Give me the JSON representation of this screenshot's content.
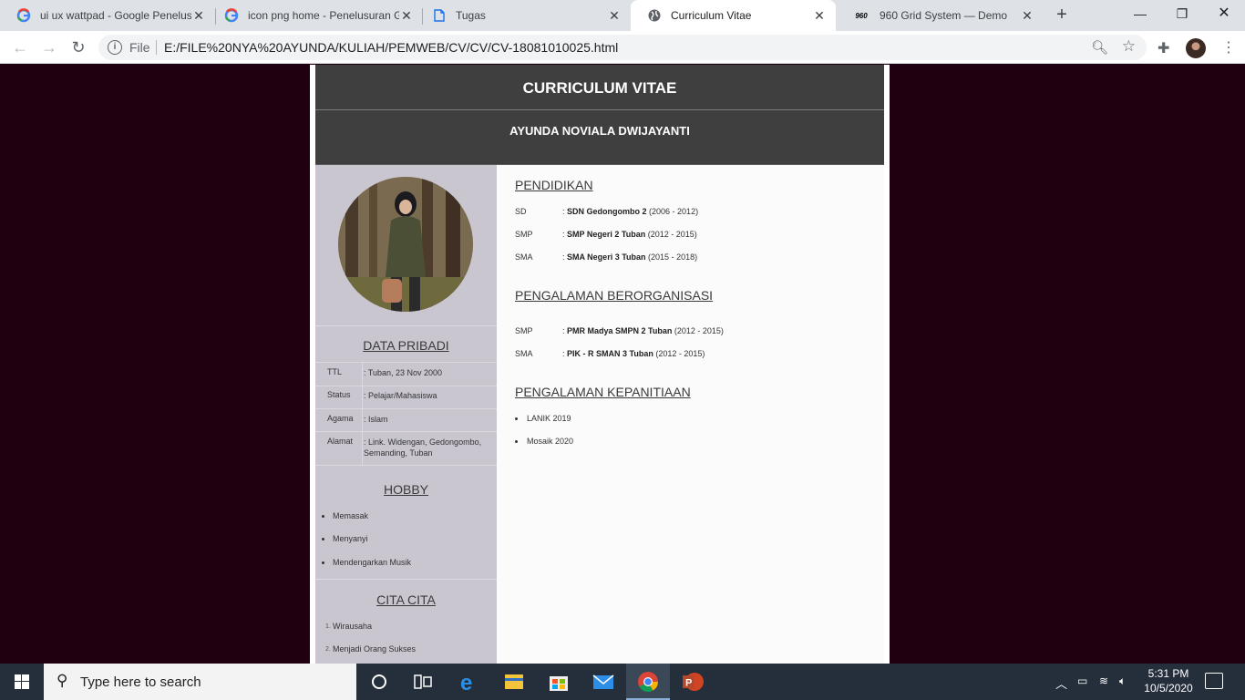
{
  "browser": {
    "tabs": [
      {
        "title": "ui ux wattpad - Google Penelusuran",
        "favicon": "google-icon"
      },
      {
        "title": "icon png home - Penelusuran Google",
        "favicon": "google-icon"
      },
      {
        "title": "Tugas",
        "favicon": "file-icon"
      },
      {
        "title": "Curriculum Vitae",
        "favicon": "globe-icon"
      },
      {
        "title": "960 Grid System — Demo",
        "favicon": "960-icon"
      }
    ],
    "active_tab": 3,
    "address": {
      "scheme_label": "File",
      "url": "E:/FILE%20NYA%20AYUNDA/KULIAH/PEMWEB/CV/CV/CV-18081010025.html"
    }
  },
  "cv": {
    "title": "CURRICULUM VITAE",
    "name": "AYUNDA NOVIALA DWIJAYANTI",
    "data_pribadi": {
      "heading": "DATA PRIBADI",
      "rows": [
        {
          "label": "TTL",
          "value": ": Tuban, 23 Nov 2000"
        },
        {
          "label": "Status",
          "value": ": Pelajar/Mahasiswa"
        },
        {
          "label": "Agama",
          "value": ": Islam"
        },
        {
          "label": "Alamat",
          "value": ": Link. Widengan, Gedongombo, Semanding, Tuban"
        }
      ]
    },
    "hobby": {
      "heading": "HOBBY",
      "items": [
        "Memasak",
        "Menyanyi",
        "Mendengarkan Musik"
      ]
    },
    "cita_cita": {
      "heading": "CITA CITA",
      "items": [
        "Wirausaha",
        "Menjadi Orang Sukses"
      ]
    },
    "pendidikan": {
      "heading": "PENDIDIKAN",
      "rows": [
        {
          "level": "SD",
          "school": "SDN Gedongombo 2",
          "years": "(2006 - 2012)"
        },
        {
          "level": "SMP",
          "school": "SMP Negeri 2 Tuban",
          "years": "(2012 - 2015)"
        },
        {
          "level": "SMA",
          "school": "SMA Negeri 3 Tuban",
          "years": "(2015 - 2018)"
        }
      ]
    },
    "organisasi": {
      "heading": "PENGALAMAN BERORGANISASI",
      "rows": [
        {
          "level": "SMP",
          "school": "PMR Madya SMPN 2 Tuban",
          "years": "(2012 - 2015)"
        },
        {
          "level": "SMA",
          "school": "PIK - R SMAN 3 Tuban",
          "years": "(2012 - 2015)"
        }
      ]
    },
    "kepanitiaan": {
      "heading": "PENGALAMAN KEPANITIAAN",
      "items": [
        "LANIK 2019",
        "Mosaik 2020"
      ]
    }
  },
  "taskbar": {
    "search_placeholder": "Type here to search",
    "time": "5:31 PM",
    "date": "10/5/2020"
  },
  "colors": {
    "page_background": "#200010",
    "header": "#3f3f3f",
    "sidebar": "#c9c6d0",
    "taskbar": "#252f3c"
  }
}
